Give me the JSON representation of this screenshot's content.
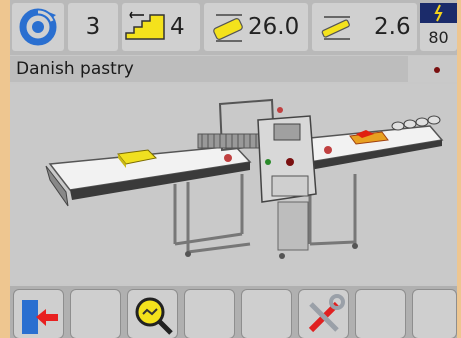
{
  "status": {
    "count": "3",
    "steps": "4",
    "thickness_start": "26.0",
    "thickness_end": "2.6",
    "speed": "80"
  },
  "program": {
    "name": "Danish pastry"
  },
  "softkeys": [
    {
      "name": "exit",
      "icon": "exit-door-icon"
    },
    {
      "name": "empty-1",
      "icon": ""
    },
    {
      "name": "search",
      "icon": "magnifier-icon"
    },
    {
      "name": "empty-2",
      "icon": ""
    },
    {
      "name": "empty-3",
      "icon": ""
    },
    {
      "name": "tools",
      "icon": "tools-icon"
    },
    {
      "name": "empty-4",
      "icon": ""
    },
    {
      "name": "empty-5",
      "icon": ""
    }
  ],
  "colors": {
    "frame": "#eec690",
    "accent_blue": "#2a6fd0",
    "dough_yellow": "#f0e020"
  }
}
